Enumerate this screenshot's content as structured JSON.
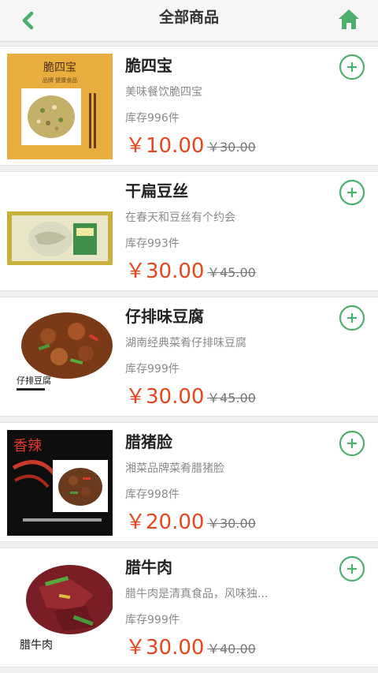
{
  "header": {
    "title": "全部商品",
    "back_icon": "chevron-left-icon",
    "home_icon": "home-icon",
    "accent": "#4caf6e"
  },
  "products": [
    {
      "name": "脆四宝",
      "desc": "美味餐饮脆四宝",
      "stock": "库存996件",
      "price": "￥10.00",
      "orig_price": "￥30.00",
      "image_text": "脆四宝",
      "image_subtext": "品牌  健康食品"
    },
    {
      "name": "干扁豆丝",
      "desc": "在春天和豆丝有个约会",
      "stock": "库存993件",
      "price": "￥30.00",
      "orig_price": "￥45.00"
    },
    {
      "name": "仔排味豆腐",
      "desc": "湖南经典菜肴仔排味豆腐",
      "stock": "库存999件",
      "price": "￥30.00",
      "orig_price": "￥45.00",
      "image_text": "仔排豆腐"
    },
    {
      "name": "腊猪脸",
      "desc": "湘菜品牌菜肴腊猪脸",
      "stock": "库存998件",
      "price": "￥20.00",
      "orig_price": "￥30.00",
      "image_text": "香辣"
    },
    {
      "name": "腊牛肉",
      "desc": "腊牛肉是清真食品，风味独...",
      "stock": "库存999件",
      "price": "￥30.00",
      "orig_price": "￥40.00",
      "image_text": "腊牛肉"
    }
  ]
}
